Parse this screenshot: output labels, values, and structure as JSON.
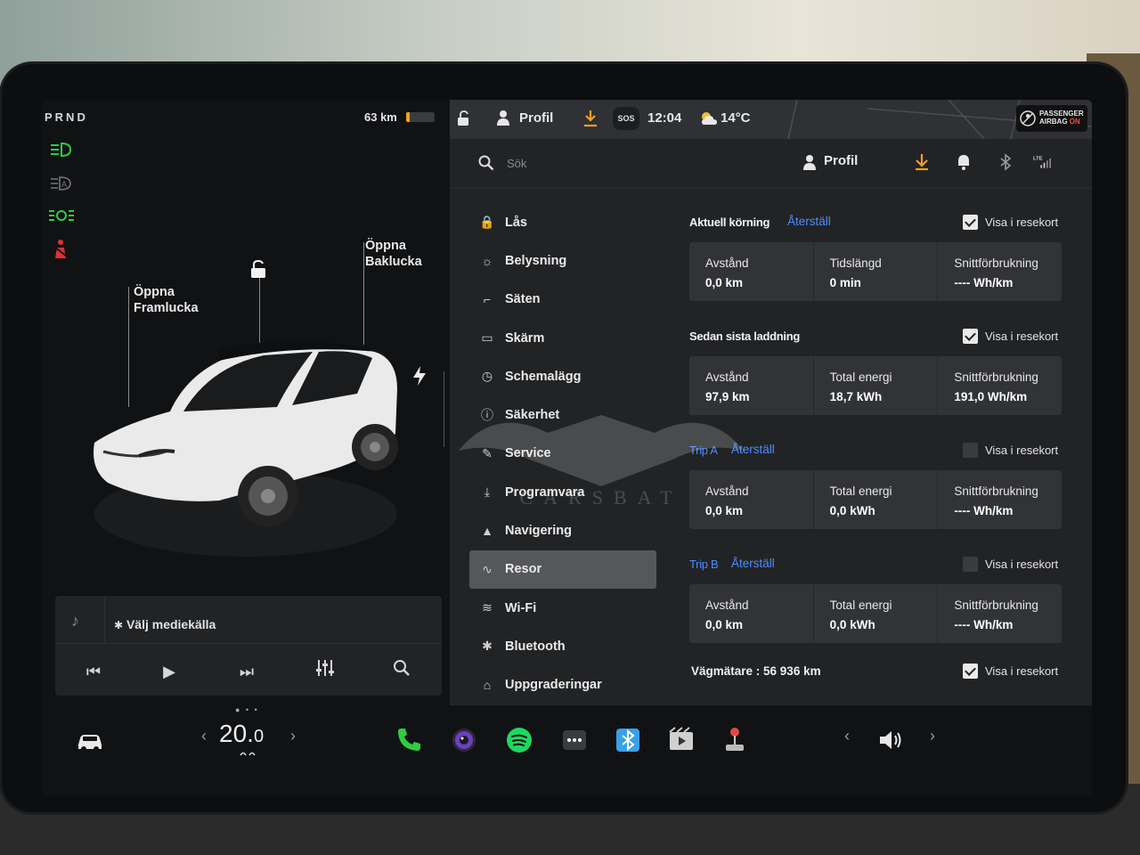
{
  "car": {
    "gear": "PRND",
    "range": "63 km",
    "battery_level": 0.12,
    "label_rear": [
      "Öppna",
      "Baklucka"
    ],
    "label_front": [
      "Öppna",
      "Framlucka"
    ]
  },
  "media": {
    "source": "Välj mediekälla"
  },
  "status_bar": {
    "profile": "Profil",
    "sos": "SOS",
    "time": "12:04",
    "temperature": "14°C",
    "airbag_line1": "PASSENGER",
    "airbag_line2": "AIRBAG",
    "airbag_state": "ON"
  },
  "search": {
    "placeholder": "Sök"
  },
  "header": {
    "profile": "Profil"
  },
  "menu": [
    {
      "label": "Lås",
      "icon": "lock-icon"
    },
    {
      "label": "Belysning",
      "icon": "light-icon"
    },
    {
      "label": "Säten",
      "icon": "seat-icon"
    },
    {
      "label": "Skärm",
      "icon": "display-icon"
    },
    {
      "label": "Schemalägg",
      "icon": "clock-icon"
    },
    {
      "label": "Säkerhet",
      "icon": "safety-icon"
    },
    {
      "label": "Service",
      "icon": "wrench-icon"
    },
    {
      "label": "Programvara",
      "icon": "download-icon"
    },
    {
      "label": "Navigering",
      "icon": "navigation-icon"
    },
    {
      "label": "Resor",
      "icon": "trips-icon",
      "active": true
    },
    {
      "label": "Wi-Fi",
      "icon": "wifi-icon"
    },
    {
      "label": "Bluetooth",
      "icon": "bluetooth-icon"
    },
    {
      "label": "Uppgraderingar",
      "icon": "bag-icon"
    }
  ],
  "trips": {
    "current": {
      "title": "Aktuell körning",
      "reset": "Återställ",
      "show_label": "Visa i resekort",
      "checked": true,
      "stats": [
        {
          "label": "Avstånd",
          "value": "0,0 km"
        },
        {
          "label": "Tidslängd",
          "value": "0 min"
        },
        {
          "label": "Snittförbrukning",
          "value": "---- Wh/km"
        }
      ]
    },
    "since_charge": {
      "title": "Sedan sista laddning",
      "show_label": "Visa i resekort",
      "checked": true,
      "stats": [
        {
          "label": "Avstånd",
          "value": "97,9 km"
        },
        {
          "label": "Total energi",
          "value": "18,7 kWh"
        },
        {
          "label": "Snittförbrukning",
          "value": "191,0 Wh/km"
        }
      ]
    },
    "trip_a": {
      "title": "Trip A",
      "reset": "Återställ",
      "show_label": "Visa i resekort",
      "checked": false,
      "stats": [
        {
          "label": "Avstånd",
          "value": "0,0 km"
        },
        {
          "label": "Total energi",
          "value": "0,0 kWh"
        },
        {
          "label": "Snittförbrukning",
          "value": "---- Wh/km"
        }
      ]
    },
    "trip_b": {
      "title": "Trip B",
      "reset": "Återställ",
      "show_label": "Visa i resekort",
      "checked": false,
      "stats": [
        {
          "label": "Avstånd",
          "value": "0,0 km"
        },
        {
          "label": "Total energi",
          "value": "0,0 kWh"
        },
        {
          "label": "Snittförbrukning",
          "value": "---- Wh/km"
        }
      ]
    },
    "odometer": {
      "text": "Vägmätare : 56 936 km",
      "show_label": "Visa i resekort",
      "checked": true
    }
  },
  "dock": {
    "temp_int": "20.",
    "temp_dec": "0",
    "apps": [
      "phone-icon",
      "camera-icon",
      "spotify-icon",
      "more-icon",
      "bluetooth-icon",
      "theater-icon",
      "joystick-icon"
    ]
  },
  "watermark": "CARSBAT",
  "colors": {
    "accent_blue": "#4d8cff",
    "download_orange": "#f0a020",
    "green_light": "#2ecc40",
    "warning_red": "#e03030"
  }
}
